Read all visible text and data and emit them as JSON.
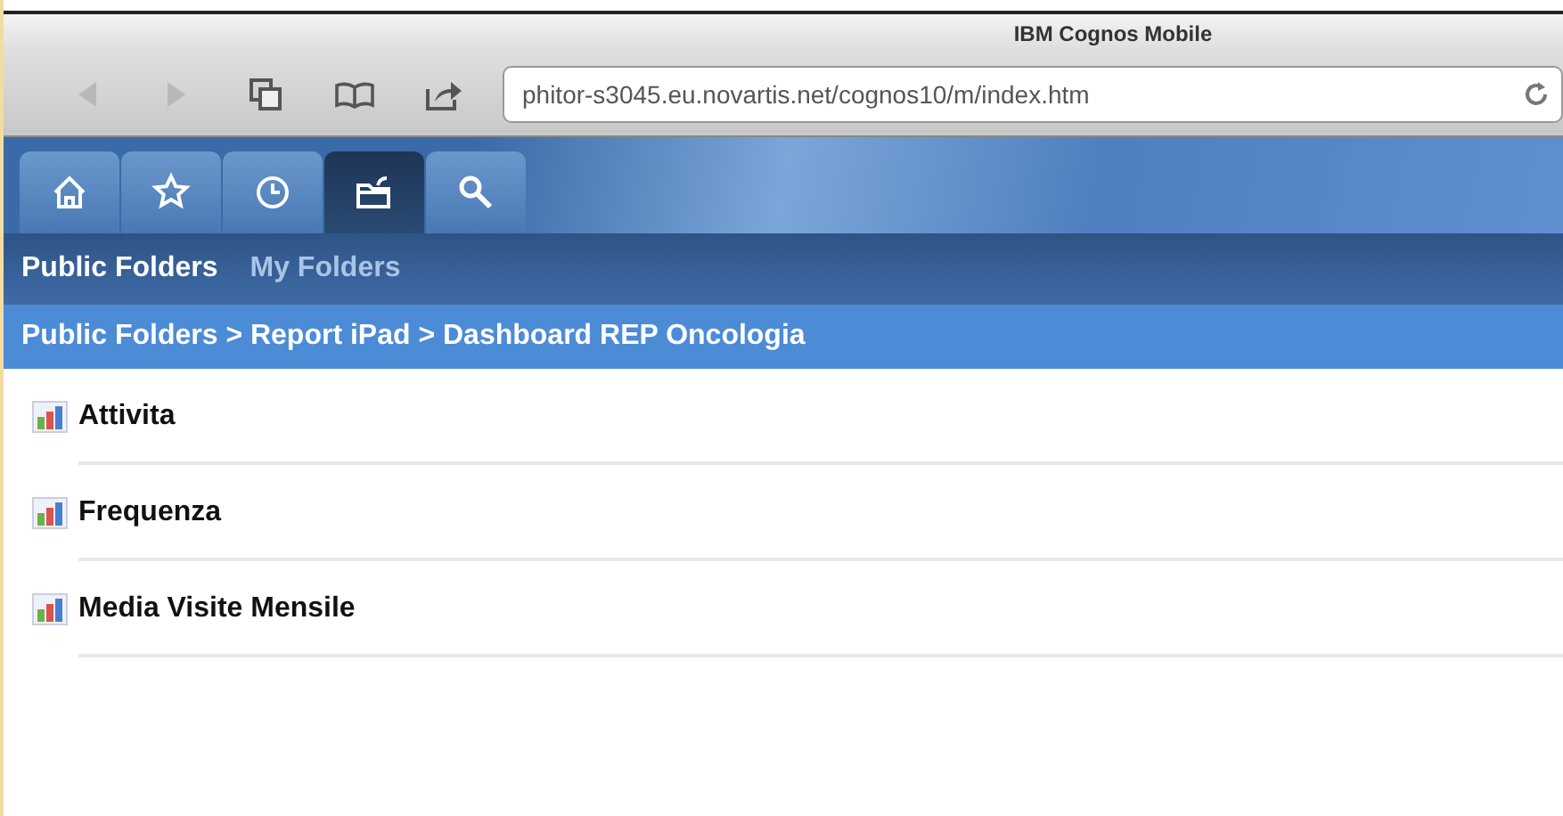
{
  "window": {
    "title": "IBM Cognos Mobile"
  },
  "toolbar": {
    "buttons": [
      {
        "kind": "back",
        "disabled": true
      },
      {
        "kind": "forward",
        "disabled": true
      },
      {
        "kind": "pages",
        "disabled": false
      },
      {
        "kind": "bookmarks",
        "disabled": false
      },
      {
        "kind": "share",
        "disabled": false
      }
    ],
    "address": "phitor-s3045.eu.novartis.net/cognos10/m/index.htm"
  },
  "tabs": [
    {
      "kind": "home",
      "selected": false
    },
    {
      "kind": "favorites",
      "selected": false
    },
    {
      "kind": "recent",
      "selected": false
    },
    {
      "kind": "folders",
      "selected": true
    },
    {
      "kind": "search",
      "selected": false
    }
  ],
  "folder_tabs": [
    {
      "label": "Public Folders",
      "selected": true
    },
    {
      "label": "My Folders",
      "selected": false
    }
  ],
  "breadcrumb": "Public Folders > Report iPad > Dashboard REP Oncologia",
  "reports": [
    {
      "name": "Attivita"
    },
    {
      "name": "Frequenza"
    },
    {
      "name": "Media Visite Mensile"
    }
  ]
}
